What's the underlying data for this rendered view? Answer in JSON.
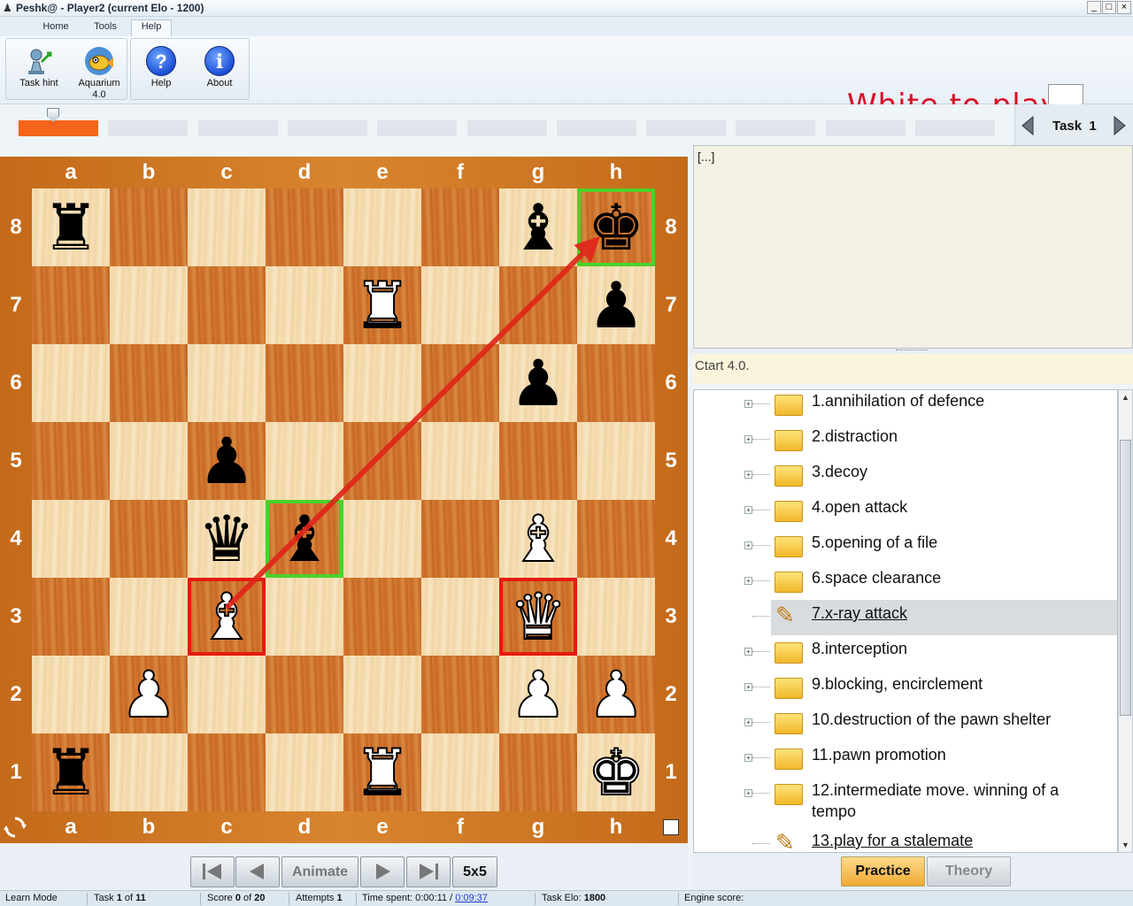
{
  "window": {
    "title": "Peshk@ - Player2 (current Elo - 1200)",
    "controls": [
      "_",
      "□",
      "×"
    ]
  },
  "ribbon": {
    "tabs": [
      "Home",
      "Tools",
      "Help"
    ],
    "active_tab": "Help",
    "buttons": {
      "task_hint": "Task hint",
      "aquarium": "Aquarium",
      "aquarium_version": "4.0",
      "help": "Help",
      "about": "About"
    }
  },
  "status_message": "White to play",
  "progress": {
    "segments": 11,
    "completed": 1
  },
  "task_nav": {
    "label": "Task",
    "number": "1"
  },
  "board": {
    "files": [
      "a",
      "b",
      "c",
      "d",
      "e",
      "f",
      "g",
      "h"
    ],
    "ranks": [
      "8",
      "7",
      "6",
      "5",
      "4",
      "3",
      "2",
      "1"
    ],
    "pieces": [
      {
        "square": "a8",
        "piece": "rook",
        "color": "black"
      },
      {
        "square": "g8",
        "piece": "bishop",
        "color": "black"
      },
      {
        "square": "h8",
        "piece": "king",
        "color": "black"
      },
      {
        "square": "e7",
        "piece": "rook",
        "color": "white"
      },
      {
        "square": "h7",
        "piece": "pawn",
        "color": "black"
      },
      {
        "square": "g6",
        "piece": "pawn",
        "color": "black"
      },
      {
        "square": "c5",
        "piece": "pawn",
        "color": "black"
      },
      {
        "square": "c4",
        "piece": "queen",
        "color": "black"
      },
      {
        "square": "d4",
        "piece": "bishop",
        "color": "black"
      },
      {
        "square": "g4",
        "piece": "bishop",
        "color": "white"
      },
      {
        "square": "c3",
        "piece": "bishop",
        "color": "white"
      },
      {
        "square": "g3",
        "piece": "queen",
        "color": "white"
      },
      {
        "square": "b2",
        "piece": "pawn",
        "color": "white"
      },
      {
        "square": "g2",
        "piece": "pawn",
        "color": "white"
      },
      {
        "square": "h2",
        "piece": "pawn",
        "color": "white"
      },
      {
        "square": "a1",
        "piece": "rook",
        "color": "black"
      },
      {
        "square": "e1",
        "piece": "rook",
        "color": "white"
      },
      {
        "square": "h1",
        "piece": "king",
        "color": "white"
      }
    ],
    "highlights_green": [
      "h8",
      "d4"
    ],
    "highlights_red": [
      "c3",
      "g3"
    ],
    "arrow": {
      "from": "c3",
      "to": "h8",
      "color": "#e0231a"
    }
  },
  "nav_buttons": {
    "first": "⏮",
    "prev": "◀",
    "animate": "Animate",
    "next": "▶",
    "last": "⏭",
    "size": "5x5"
  },
  "notes": {
    "text": "[...]"
  },
  "course": {
    "title": "Ctart 4.0.",
    "items": [
      {
        "label": "1.annihilation of defence",
        "icon": "folder-icon"
      },
      {
        "label": "2.distraction",
        "icon": "folder-icon"
      },
      {
        "label": "3.decoy",
        "icon": "folder-icon"
      },
      {
        "label": "4.open attack",
        "icon": "folder-icon"
      },
      {
        "label": "5.opening of a file",
        "icon": "folder-icon"
      },
      {
        "label": "6.space clearance",
        "icon": "folder-icon"
      },
      {
        "label": "7.x-ray attack",
        "icon": "pencil-icon",
        "selected": true
      },
      {
        "label": "8.interception",
        "icon": "folder-icon"
      },
      {
        "label": "9.blocking, encirclement",
        "icon": "folder-icon"
      },
      {
        "label": "10.destruction of the pawn shelter",
        "icon": "folder-icon"
      },
      {
        "label": "11.pawn promotion",
        "icon": "folder-icon"
      },
      {
        "label": "12.intermediate move. winning of a tempo",
        "icon": "folder-icon"
      },
      {
        "label": "13.play for a stalemate",
        "icon": "pencil-icon"
      }
    ]
  },
  "mode": {
    "practice": "Practice",
    "theory": "Theory",
    "active": "Practice"
  },
  "statusbar": {
    "mode": "Learn Mode",
    "task_prefix": "Task",
    "task_num": "1",
    "task_of": "of",
    "task_total": "11",
    "score_prefix": "Score",
    "score_val": "0",
    "score_of": "of",
    "score_total": "20",
    "attempts_prefix": "Attempts",
    "attempts_val": "1",
    "time_prefix": "Time spent:",
    "time_spent": "0:00:11",
    "time_sep": "/",
    "time_total": "0:09:37",
    "elo_prefix": "Task Elo:",
    "elo_val": "1800",
    "engine_label": "Engine score:"
  },
  "colors": {
    "status_red": "#d8102a",
    "practice_bg": "#f6c15a",
    "highlight_green": "#4cd12a",
    "highlight_red": "#e41b10"
  }
}
